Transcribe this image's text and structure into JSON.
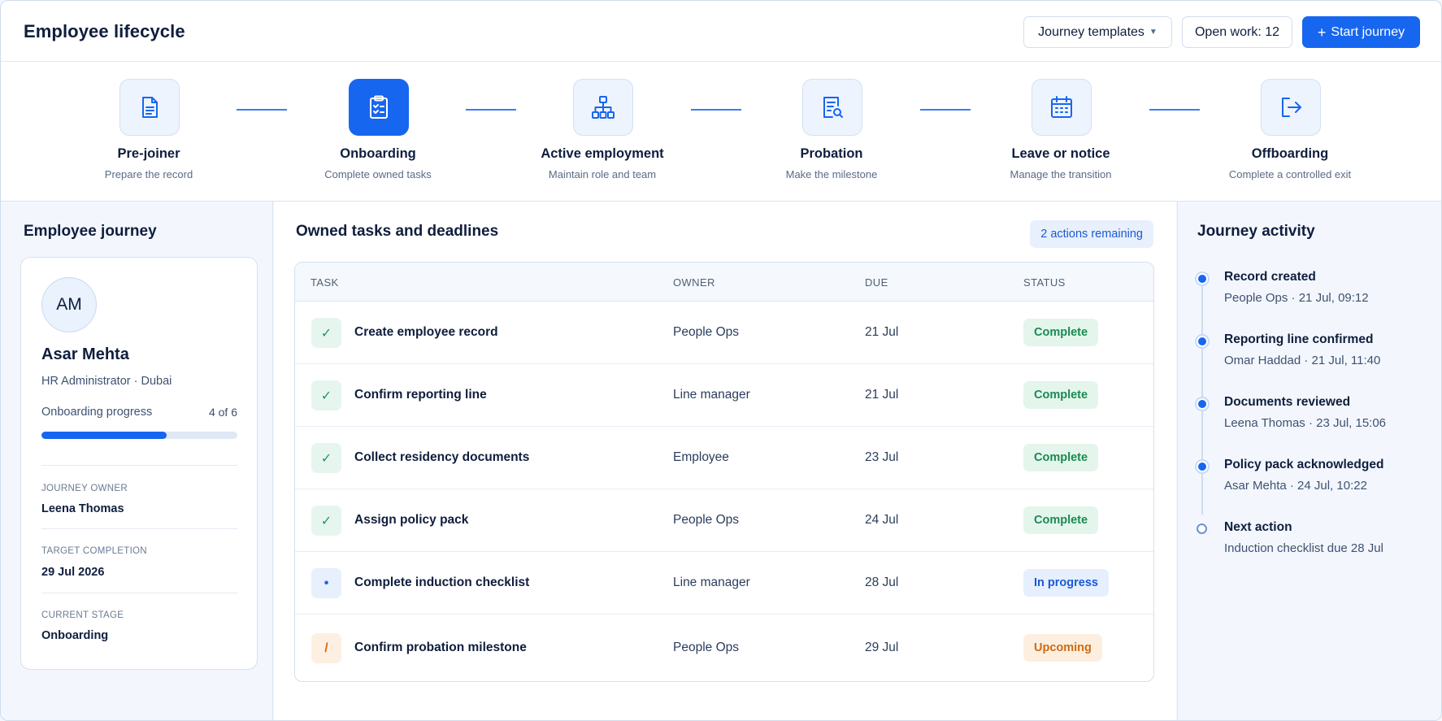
{
  "header": {
    "title": "Employee lifecycle",
    "templates_label": "Journey templates",
    "open_work_label": "Open work: 12",
    "start_label": "Start journey"
  },
  "stepper": [
    {
      "label": "Pre-joiner",
      "sub": "Prepare the record",
      "icon": "document-icon"
    },
    {
      "label": "Onboarding",
      "sub": "Complete owned tasks",
      "icon": "clipboard-check-icon",
      "active": true
    },
    {
      "label": "Active employment",
      "sub": "Maintain role and team",
      "icon": "org-chart-icon"
    },
    {
      "label": "Probation",
      "sub": "Make the milestone",
      "icon": "document-review-icon"
    },
    {
      "label": "Leave or notice",
      "sub": "Manage the transition",
      "icon": "calendar-icon"
    },
    {
      "label": "Offboarding",
      "sub": "Complete a controlled exit",
      "icon": "exit-icon"
    }
  ],
  "left": {
    "title": "Employee journey",
    "initials": "AM",
    "name": "Asar Mehta",
    "role": "HR Administrator · Dubai",
    "progress_label": "Onboarding progress",
    "progress_count": "4 of 6",
    "progress_fraction": 0.64,
    "owner_label": "JOURNEY OWNER",
    "owner_value": "Leena Thomas",
    "target_label": "TARGET COMPLETION",
    "target_value": "29 Jul 2026",
    "stage_label": "CURRENT STAGE",
    "stage_value": "Onboarding"
  },
  "center": {
    "title": "Owned tasks and deadlines",
    "remaining": "2 actions remaining",
    "columns": {
      "task": "TASK",
      "owner": "OWNER",
      "due": "DUE",
      "status": "STATUS"
    },
    "rows": [
      {
        "task": "Create employee record",
        "owner": "People Ops",
        "due": "21 Jul",
        "status": "Complete",
        "kind": "done",
        "glyph": "✓"
      },
      {
        "task": "Confirm reporting line",
        "owner": "Line manager",
        "due": "21 Jul",
        "status": "Complete",
        "kind": "done",
        "glyph": "✓"
      },
      {
        "task": "Collect residency documents",
        "owner": "Employee",
        "due": "23 Jul",
        "status": "Complete",
        "kind": "done",
        "glyph": "✓"
      },
      {
        "task": "Assign policy pack",
        "owner": "People Ops",
        "due": "24 Jul",
        "status": "Complete",
        "kind": "done",
        "glyph": "✓"
      },
      {
        "task": "Complete induction checklist",
        "owner": "Line manager",
        "due": "28 Jul",
        "status": "In progress",
        "kind": "progress",
        "glyph": "•"
      },
      {
        "task": "Confirm probation milestone",
        "owner": "People Ops",
        "due": "29 Jul",
        "status": "Upcoming",
        "kind": "upcoming",
        "glyph": "/"
      }
    ]
  },
  "activity": {
    "title": "Journey activity",
    "items": [
      {
        "title": "Record created",
        "sub": "People Ops · 21 Jul, 09:12"
      },
      {
        "title": "Reporting line confirmed",
        "sub": "Omar Haddad · 21 Jul, 11:40"
      },
      {
        "title": "Documents reviewed",
        "sub": "Leena Thomas · 23 Jul, 15:06"
      },
      {
        "title": "Policy pack acknowledged",
        "sub": "Asar Mehta · 24 Jul, 10:22"
      },
      {
        "title": "Next action",
        "sub": "Induction checklist due 28 Jul",
        "pending": true
      }
    ]
  },
  "colors": {
    "accent": "#1766f0",
    "complete": "#1a8a52",
    "upcoming": "#cf6a12"
  }
}
